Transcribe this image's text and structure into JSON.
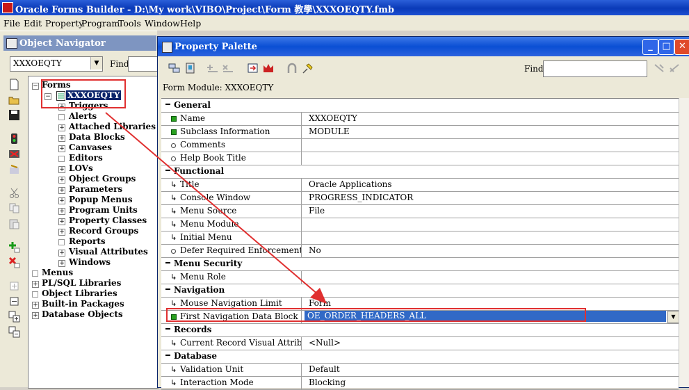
{
  "app": {
    "title": "Oracle Forms Builder - D:\\My work\\VIBO\\Project\\Form 教學\\XXXOEQTY.fmb"
  },
  "menubar": [
    "File",
    "Edit",
    "Property",
    "Program",
    "Tools",
    "Window",
    "Help"
  ],
  "object_navigator": {
    "title": "Object Navigator",
    "selected_module": "XXXOEQTY",
    "find_label": "Find:",
    "find_value": "",
    "tree": {
      "forms_label": "Forms",
      "module": "XXXOEQTY",
      "module_children": [
        "Triggers",
        "Alerts",
        "Attached Libraries",
        "Data Blocks",
        "Canvases",
        "Editors",
        "LOVs",
        "Object Groups",
        "Parameters",
        "Popup Menus",
        "Program Units",
        "Property Classes",
        "Record Groups",
        "Reports",
        "Visual Attributes",
        "Windows"
      ],
      "top_level": [
        "Menus",
        "PL/SQL Libraries",
        "Object Libraries",
        "Built-in Packages",
        "Database Objects"
      ]
    }
  },
  "property_palette": {
    "title": "Property Palette",
    "find_label": "Find:",
    "find_value": "",
    "module_label": "Form Module: XXXOEQTY",
    "rows": [
      {
        "type": "category",
        "name": "General"
      },
      {
        "type": "prop",
        "marker": "square",
        "name": "Name",
        "value": "XXXOEQTY"
      },
      {
        "type": "prop",
        "marker": "square",
        "name": "Subclass Information",
        "value": "MODULE"
      },
      {
        "type": "prop",
        "marker": "dot",
        "name": "Comments",
        "value": ""
      },
      {
        "type": "prop",
        "marker": "dot",
        "name": "Help Book Title",
        "value": ""
      },
      {
        "type": "category",
        "name": "Functional"
      },
      {
        "type": "prop",
        "marker": "arrow",
        "name": "Title",
        "value": "Oracle Applications"
      },
      {
        "type": "prop",
        "marker": "arrow",
        "name": "Console Window",
        "value": "PROGRESS_INDICATOR"
      },
      {
        "type": "prop",
        "marker": "arrow",
        "name": "Menu Source",
        "value": "File"
      },
      {
        "type": "prop",
        "marker": "arrow",
        "name": "Menu Module",
        "value": ""
      },
      {
        "type": "prop",
        "marker": "arrow",
        "name": "Initial Menu",
        "value": ""
      },
      {
        "type": "prop",
        "marker": "dot",
        "name": "Defer Required Enforcement",
        "value": "No"
      },
      {
        "type": "category",
        "name": "Menu Security"
      },
      {
        "type": "prop",
        "marker": "arrow",
        "name": "Menu Role",
        "value": ""
      },
      {
        "type": "category",
        "name": "Navigation"
      },
      {
        "type": "prop",
        "marker": "arrow",
        "name": "Mouse Navigation Limit",
        "value": "Form"
      },
      {
        "type": "selected",
        "marker": "square",
        "name": "First Navigation Data Block",
        "value": "OE_ORDER_HEADERS_ALL"
      },
      {
        "type": "category",
        "name": "Records"
      },
      {
        "type": "prop",
        "marker": "arrow",
        "name": "Current Record Visual Attribute Grou",
        "value": "<Null>"
      },
      {
        "type": "category",
        "name": "Database"
      },
      {
        "type": "prop",
        "marker": "arrow",
        "name": "Validation Unit",
        "value": "Default"
      },
      {
        "type": "prop",
        "marker": "arrow",
        "name": "Interaction Mode",
        "value": "Blocking"
      }
    ]
  },
  "colors": {
    "annotation_red": "#e03030",
    "selection_blue": "#3169c6",
    "title_blue": "#0a4fd4"
  }
}
